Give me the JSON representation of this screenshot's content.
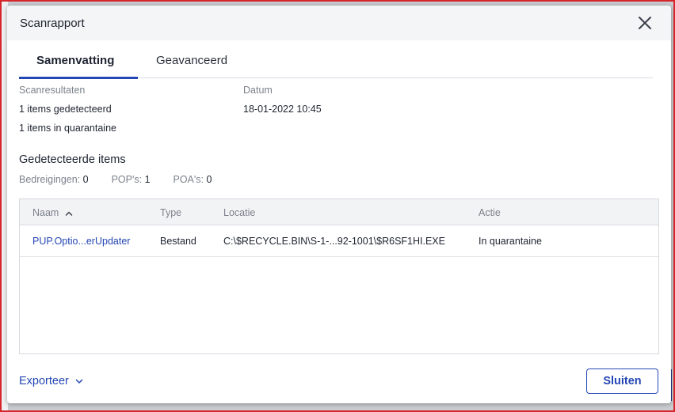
{
  "dialog": {
    "title": "Scanrapport"
  },
  "tabs": [
    {
      "label": "Samenvatting"
    },
    {
      "label": "Geavanceerd"
    }
  ],
  "summary": {
    "results_label": "Scanresultaten",
    "detected": "1 items gedetecteerd",
    "quarantined": "1 items in quarantaine",
    "date_label": "Datum",
    "date_value": "18-01-2022 10:45"
  },
  "detected_items": {
    "title": "Gedetecteerde items",
    "threats_label": "Bedreigingen:",
    "threats_value": "0",
    "pups_label": "POP's:",
    "pups_value": "1",
    "pums_label": "POA's:",
    "pums_value": "0"
  },
  "table": {
    "columns": [
      "Naam",
      "Type",
      "Locatie",
      "Actie"
    ],
    "rows": [
      {
        "name": "PUP.Optio...erUpdater",
        "type": "Bestand",
        "location": "C:\\$RECYCLE.BIN\\S-1-...92-1001\\$R6SF1HI.EXE",
        "action": "In quarantaine"
      }
    ]
  },
  "footer": {
    "export_label": "Exporteer",
    "close_label": "Sluiten"
  },
  "icons": {
    "close": "close-icon",
    "sort": "sort-ascending-icon",
    "dropdown": "chevron-down-icon"
  },
  "colors": {
    "accent": "#2446b4",
    "muted_text": "#7c828c"
  }
}
